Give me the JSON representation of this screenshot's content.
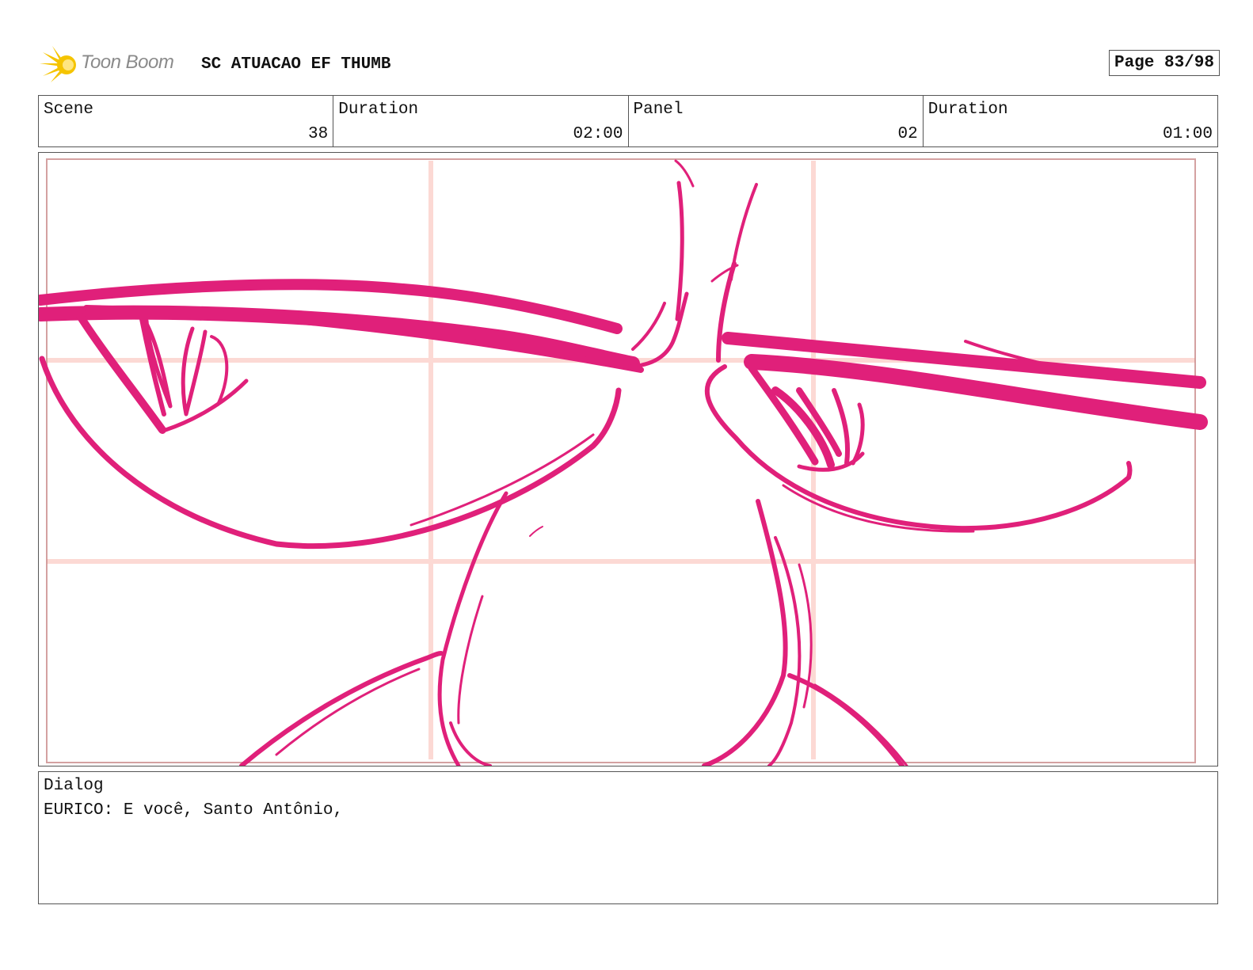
{
  "header": {
    "logo_text": "Toon Boom",
    "title": "SC ATUACAO EF THUMB",
    "page": "Page 83/98"
  },
  "info": {
    "scene_label": "Scene",
    "scene_value": "38",
    "scene_duration_label": "Duration",
    "scene_duration_value": "02:00",
    "panel_label": "Panel",
    "panel_value": "02",
    "panel_duration_label": "Duration",
    "panel_duration_value": "01:00"
  },
  "dialog": {
    "label": "Dialog",
    "text": "EURICO: E você, Santo Antônio,"
  },
  "colors": {
    "sketch": "#e0207a",
    "guide": "#fcd9d4",
    "safe_frame": "#c98a8a",
    "logo_flare": "#f5c400"
  },
  "icons": {
    "logo": "toon-boom-flare-icon"
  }
}
